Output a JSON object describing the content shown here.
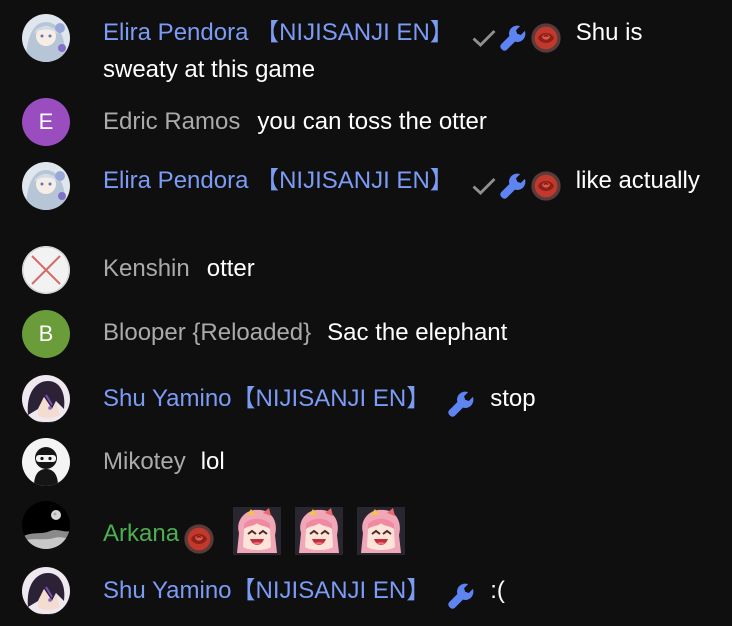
{
  "chat": {
    "messages": [
      {
        "author": "Elira Pendora 【NIJISANJI EN】",
        "text": "Shu is sweaty at this game"
      },
      {
        "author": "Edric Ramos",
        "avatar_letter": "E",
        "avatar_color": "#9a4dbf",
        "text": "you can toss the otter"
      },
      {
        "author": "Elira Pendora 【NIJISANJI EN】",
        "text": "like actually"
      },
      {
        "author": "Kenshin",
        "text": "otter"
      },
      {
        "author": "Blooper {Reloaded}",
        "avatar_letter": "B",
        "avatar_color": "#6a9c3a",
        "text": "Sac the elephant"
      },
      {
        "author": "Shu Yamino【NIJISANJI EN】",
        "text": "stop"
      },
      {
        "author": "Mikotey",
        "text": "lol"
      },
      {
        "author": "Arkana",
        "text": ""
      },
      {
        "author": "Shu Yamino【NIJISANJI EN】",
        "text": ":("
      }
    ]
  },
  "colors": {
    "background": "#0f0f0f",
    "owner_name": "#7b9bf5",
    "member_name": "#4caf50",
    "viewer_name": "#aaaaaa",
    "message_text": "#ffffff"
  },
  "icons": {
    "verified": "checkmark-icon",
    "moderator": "wrench-icon",
    "membership": "rose-badge-icon",
    "emote": "anime-girl-emote"
  }
}
